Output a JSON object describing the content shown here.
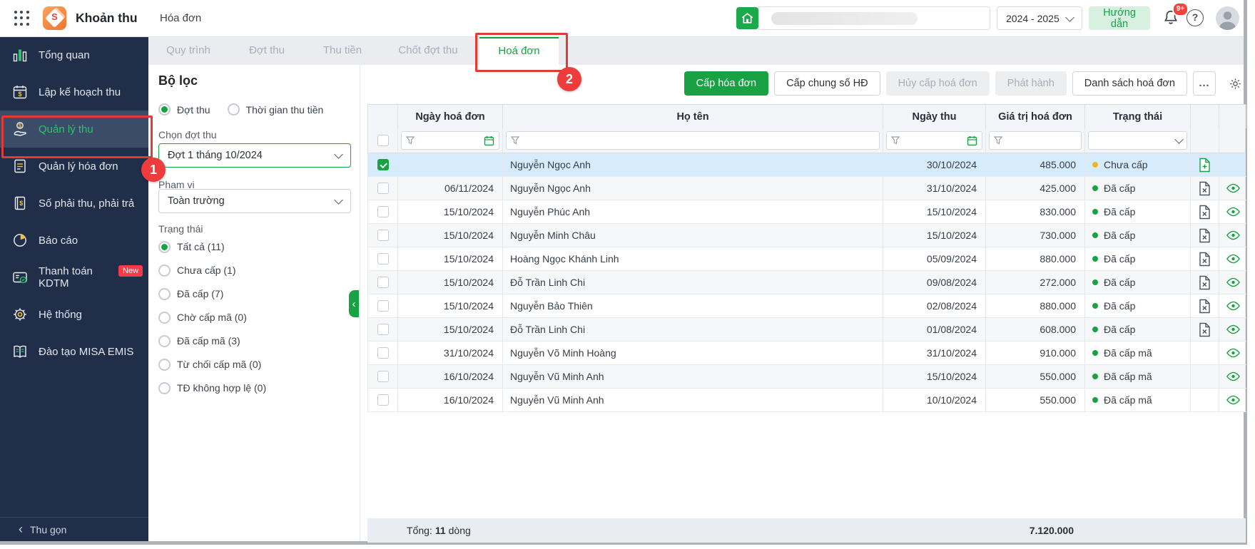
{
  "colors": {
    "accent_green": "#18a243",
    "annotation_red": "#e23a34",
    "status_yellow": "#f0b429",
    "status_green": "#18a243",
    "sidebar_bg": "#202e4a",
    "selected_row_blue": "#d6ebfb"
  },
  "header": {
    "app_title": "Khoản thu",
    "breadcrumb": "Hóa đơn",
    "school_year": "2024 - 2025",
    "guide_button": "Hướng dẫn",
    "notification_badge": "9+",
    "help_glyph": "?"
  },
  "sidebar": {
    "items": [
      {
        "key": "tong-quan",
        "label": "Tổng quan",
        "icon": "chart",
        "active": false
      },
      {
        "key": "lap-ke-hoach-thu",
        "label": "Lập kế hoạch thu",
        "icon": "calendar",
        "active": false
      },
      {
        "key": "quan-ly-thu",
        "label": "Quản lý thu",
        "icon": "handcoin",
        "active": true
      },
      {
        "key": "quan-ly-hoa-don",
        "label": "Quản lý hóa đơn",
        "icon": "invoice",
        "active": false
      },
      {
        "key": "so-phai-thu-phai-tra",
        "label": "Số phải thu, phải trả",
        "icon": "ledger",
        "active": false
      },
      {
        "key": "bao-cao",
        "label": "Báo cáo",
        "icon": "pie",
        "active": false
      },
      {
        "key": "thanh-toan-kdtm",
        "label": "Thanh toán KDTM",
        "icon": "card",
        "active": false,
        "badge": "New"
      },
      {
        "key": "he-thong",
        "label": "Hệ thống",
        "icon": "gearside",
        "active": false
      },
      {
        "key": "dao-tao-misa-emis",
        "label": "Đào tạo MISA EMIS",
        "icon": "book",
        "active": false
      }
    ],
    "collapse_label": "Thu gọn"
  },
  "tabs": {
    "items": [
      {
        "key": "quy-trinh",
        "label": "Quy trình",
        "active": false
      },
      {
        "key": "dot-thu",
        "label": "Đợt thu",
        "active": false
      },
      {
        "key": "thu-tien",
        "label": "Thu tiền",
        "active": false
      },
      {
        "key": "chot-dot-thu",
        "label": "Chốt đợt thu",
        "active": false
      },
      {
        "key": "hoa-don",
        "label": "Hoá đơn",
        "active": true
      }
    ]
  },
  "filters": {
    "title": "Bộ lọc",
    "mode_options": [
      {
        "key": "dot-thu",
        "label": "Đợt thu",
        "selected": true
      },
      {
        "key": "thoi-gian-thu-tien",
        "label": "Thời gian thu tiền",
        "selected": false
      }
    ],
    "batch_label": "Chọn đợt thu",
    "batch_value": "Đợt 1 tháng 10/2024",
    "scope_label": "Phạm vi",
    "scope_value": "Toàn trường",
    "status_label": "Trạng thái",
    "status_options": [
      {
        "key": "tat-ca",
        "label": "Tất cả (11)",
        "selected": true
      },
      {
        "key": "chua-cap",
        "label": "Chưa cấp (1)",
        "selected": false
      },
      {
        "key": "da-cap",
        "label": "Đã cấp (7)",
        "selected": false
      },
      {
        "key": "cho-cap-ma",
        "label": "Chờ cấp mã (0)",
        "selected": false
      },
      {
        "key": "da-cap-ma",
        "label": "Đã cấp mã (3)",
        "selected": false
      },
      {
        "key": "tu-choi-cap-ma",
        "label": "Từ chối cấp mã (0)",
        "selected": false
      },
      {
        "key": "td-khong-hop-le",
        "label": "TĐ không hợp lệ (0)",
        "selected": false
      }
    ]
  },
  "toolbar": {
    "buttons": [
      {
        "key": "cap-hoa-don",
        "label": "Cấp hóa đơn",
        "style": "primary"
      },
      {
        "key": "cap-chung-so-hd",
        "label": "Cấp chung số HĐ",
        "style": "normal"
      },
      {
        "key": "huy-cap-hoa-don",
        "label": "Hủy cấp hoá đơn",
        "style": "disabled"
      },
      {
        "key": "phat-hanh",
        "label": "Phát hành",
        "style": "disabled"
      },
      {
        "key": "danh-sach-hoa-don",
        "label": "Danh sách hoá đơn",
        "style": "normal"
      }
    ],
    "more_label": "..."
  },
  "table": {
    "columns": [
      "Ngày hoá đơn",
      "Họ tên",
      "Ngày thu",
      "Giá trị hoá đơn",
      "Trạng thái"
    ],
    "rows": [
      {
        "invoice_date": "",
        "name": "Nguyễn Ngọc Anh",
        "collect_date": "30/10/2024",
        "amount": "485.000",
        "status": "Chưa cấp",
        "status_color": "yellow",
        "selected": true,
        "checked": true,
        "doc_action": "add",
        "can_view": false
      },
      {
        "invoice_date": "06/11/2024",
        "name": "Nguyễn Ngọc Anh",
        "collect_date": "31/10/2024",
        "amount": "425.000",
        "status": "Đã cấp",
        "status_color": "green",
        "selected": false,
        "checked": false,
        "doc_action": "cancel",
        "can_view": true
      },
      {
        "invoice_date": "15/10/2024",
        "name": "Nguyễn Phúc Anh",
        "collect_date": "15/10/2024",
        "amount": "830.000",
        "status": "Đã cấp",
        "status_color": "green",
        "selected": false,
        "checked": false,
        "doc_action": "cancel",
        "can_view": true
      },
      {
        "invoice_date": "15/10/2024",
        "name": "Nguyễn Minh Châu",
        "collect_date": "15/10/2024",
        "amount": "730.000",
        "status": "Đã cấp",
        "status_color": "green",
        "selected": false,
        "checked": false,
        "doc_action": "cancel",
        "can_view": true
      },
      {
        "invoice_date": "15/10/2024",
        "name": "Hoàng Ngọc Khánh Linh",
        "collect_date": "05/09/2024",
        "amount": "880.000",
        "status": "Đã cấp",
        "status_color": "green",
        "selected": false,
        "checked": false,
        "doc_action": "cancel",
        "can_view": true
      },
      {
        "invoice_date": "15/10/2024",
        "name": "Đỗ Trần Linh Chi",
        "collect_date": "09/08/2024",
        "amount": "272.000",
        "status": "Đã cấp",
        "status_color": "green",
        "selected": false,
        "checked": false,
        "doc_action": "cancel",
        "can_view": true
      },
      {
        "invoice_date": "15/10/2024",
        "name": "Nguyễn Bảo Thiên",
        "collect_date": "02/08/2024",
        "amount": "880.000",
        "status": "Đã cấp",
        "status_color": "green",
        "selected": false,
        "checked": false,
        "doc_action": "cancel",
        "can_view": true
      },
      {
        "invoice_date": "15/10/2024",
        "name": "Đỗ Trần Linh Chi",
        "collect_date": "01/08/2024",
        "amount": "608.000",
        "status": "Đã cấp",
        "status_color": "green",
        "selected": false,
        "checked": false,
        "doc_action": "cancel",
        "can_view": true
      },
      {
        "invoice_date": "31/10/2024",
        "name": "Nguyễn Võ Minh Hoàng",
        "collect_date": "31/10/2024",
        "amount": "910.000",
        "status": "Đã cấp mã",
        "status_color": "green",
        "selected": false,
        "checked": false,
        "doc_action": "none",
        "can_view": true
      },
      {
        "invoice_date": "16/10/2024",
        "name": "Nguyễn Vũ Minh Anh",
        "collect_date": "15/10/2024",
        "amount": "550.000",
        "status": "Đã cấp mã",
        "status_color": "green",
        "selected": false,
        "checked": false,
        "doc_action": "none",
        "can_view": true
      },
      {
        "invoice_date": "16/10/2024",
        "name": "Nguyễn Vũ Minh Anh",
        "collect_date": "10/10/2024",
        "amount": "550.000",
        "status": "Đã cấp mã",
        "status_color": "green",
        "selected": false,
        "checked": false,
        "doc_action": "none",
        "can_view": true
      }
    ]
  },
  "summary": {
    "total_label": "Tổng:",
    "total_count": "11",
    "total_unit": "dòng",
    "total_amount": "7.120.000"
  },
  "annotations": {
    "step1": "1",
    "step2": "2"
  }
}
